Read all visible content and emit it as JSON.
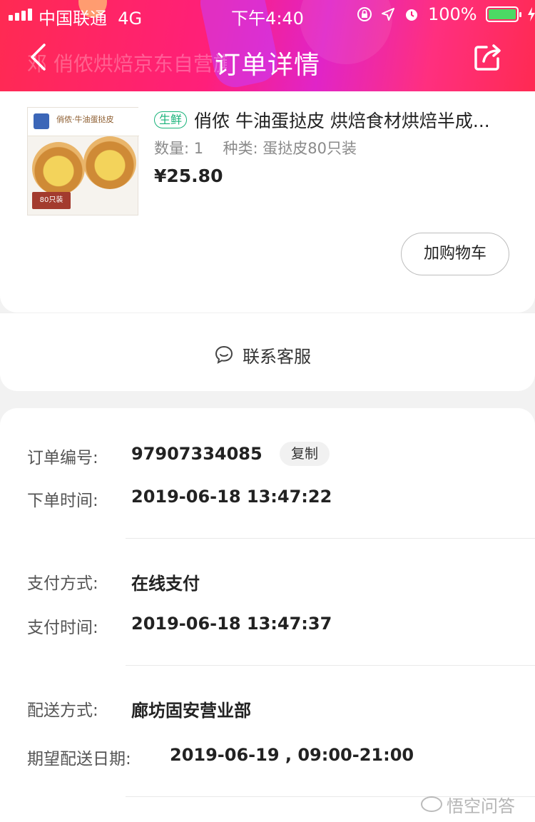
{
  "status_bar": {
    "carrier": "中国联通",
    "network": "4G",
    "time": "下午4:40",
    "battery_percent": "100%",
    "battery_level": 1.0
  },
  "nav": {
    "title": "订单详情",
    "shop_ghost": "邓 俏侬烘焙京东自营旗",
    "back_icon": "chevron-left-icon",
    "share_icon": "share-icon"
  },
  "product": {
    "tag": "生鲜",
    "name": "俏侬 牛油蛋挞皮 烘焙食材烘焙半成...",
    "quantity_label": "数量:",
    "quantity": "1",
    "variant_label": "种类:",
    "variant": "蛋挞皮80只装",
    "price": "¥25.80",
    "image_box_text": "俏侬·牛油蛋挞皮",
    "image_badge_text": "80只装",
    "add_to_cart_label": "加购物车"
  },
  "contact": {
    "label": "联系客服",
    "icon": "chat-icon"
  },
  "order_info": {
    "order_number_label": "订单编号:",
    "order_number": "97907334085",
    "copy_label": "复制",
    "order_time_label": "下单时间:",
    "order_time": "2019-06-18 13:47:22",
    "payment_method_label": "支付方式:",
    "payment_method": "在线支付",
    "payment_time_label": "支付时间:",
    "payment_time": "2019-06-18 13:47:37",
    "delivery_method_label": "配送方式:",
    "delivery_method": "廊坊固安营业部",
    "expected_date_label": "期望配送日期:",
    "expected_date": "2019-06-19 , 09:00-21:00"
  },
  "watermark": {
    "text": "悟空问答"
  },
  "colors": {
    "header_primary": "#ff2a52",
    "header_secondary": "#e024c8",
    "fresh_tag": "#19b37a",
    "battery_fill": "#4cd964"
  }
}
